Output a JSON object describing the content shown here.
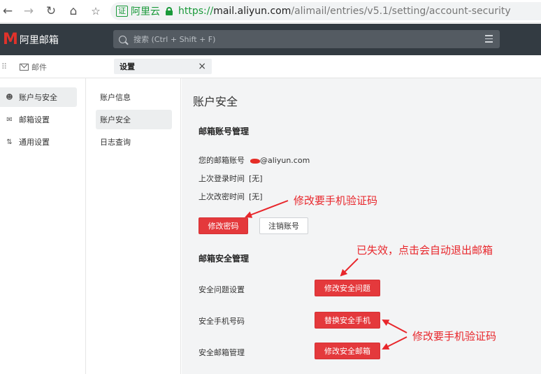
{
  "browser": {
    "cert_label": "证",
    "cert_name": "阿里云",
    "url_scheme": "https://",
    "url_host": "mail.aliyun.com",
    "url_path": "/alimail/entries/v5.1/setting/account-security"
  },
  "app": {
    "logo_text": "阿里邮箱",
    "search_placeholder": "搜索 (Ctrl + Shift + F)"
  },
  "tabs": {
    "mail_label": "邮件",
    "settings_label": "设置",
    "close_glyph": "×"
  },
  "sidebar": {
    "items": [
      {
        "label": "账户与安全",
        "active": true
      },
      {
        "label": "邮箱设置",
        "active": false
      },
      {
        "label": "通用设置",
        "active": false
      }
    ]
  },
  "submenu": {
    "items": [
      {
        "label": "账户信息",
        "active": false
      },
      {
        "label": "账户安全",
        "active": true
      },
      {
        "label": "日志查询",
        "active": false
      }
    ]
  },
  "main": {
    "title": "账户安全",
    "account_section": {
      "title": "邮箱账号管理",
      "email_label": "您的邮箱账号",
      "email_value": "@aliyun.com",
      "last_login_label": "上次登录时间",
      "last_login_value": "[无]",
      "last_pw_change_label": "上次改密时间",
      "last_pw_change_value": "[无]",
      "change_password_button": "修改密码",
      "cancel_account_button": "注销账号"
    },
    "security_section": {
      "title": "邮箱安全管理",
      "question_label": "安全问题设置",
      "question_button": "修改安全问题",
      "phone_label": "安全手机号码",
      "phone_button": "替换安全手机",
      "email_label": "安全邮箱管理",
      "email_button": "修改安全邮箱"
    }
  },
  "annotations": {
    "password_note": "修改要手机验证码",
    "question_note": "已失效，点击会自动退出邮箱",
    "phone_email_note": "修改要手机验证码"
  },
  "colors": {
    "accent_red": "#e4393c",
    "annotation_red": "#e8262b",
    "header_bg": "#333b42",
    "secure_green": "#1a9a3a"
  }
}
